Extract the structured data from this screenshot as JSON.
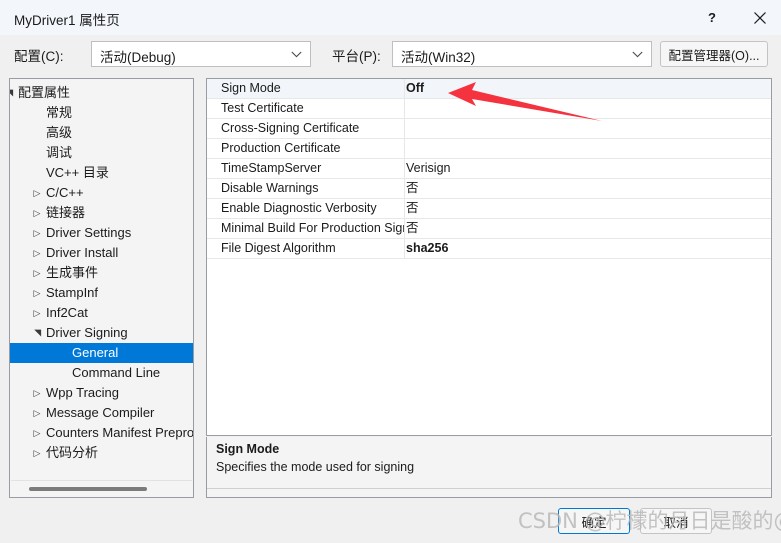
{
  "window": {
    "title": "MyDriver1 属性页",
    "help_glyph": "?",
    "close_glyph": "✕"
  },
  "config_bar": {
    "config_label": "配置(C):",
    "config_value": "活动(Debug)",
    "platform_label": "平台(P):",
    "platform_value": "活动(Win32)",
    "config_manager_button": "配置管理器(O)..."
  },
  "tree": {
    "items": [
      {
        "label": "配置属性",
        "indent": 8,
        "arrow": "▲",
        "selected": false
      },
      {
        "label": "常规",
        "indent": 36,
        "arrow": "",
        "selected": false
      },
      {
        "label": "高级",
        "indent": 36,
        "arrow": "",
        "selected": false
      },
      {
        "label": "调试",
        "indent": 36,
        "arrow": "",
        "selected": false
      },
      {
        "label": "VC++ 目录",
        "indent": 36,
        "arrow": "",
        "selected": false
      },
      {
        "label": "C/C++",
        "indent": 36,
        "arrow": "▶",
        "selected": false
      },
      {
        "label": "链接器",
        "indent": 36,
        "arrow": "▶",
        "selected": false
      },
      {
        "label": "Driver Settings",
        "indent": 36,
        "arrow": "▶",
        "selected": false
      },
      {
        "label": "Driver Install",
        "indent": 36,
        "arrow": "▶",
        "selected": false
      },
      {
        "label": "生成事件",
        "indent": 36,
        "arrow": "▶",
        "selected": false
      },
      {
        "label": "StampInf",
        "indent": 36,
        "arrow": "▶",
        "selected": false
      },
      {
        "label": "Inf2Cat",
        "indent": 36,
        "arrow": "▶",
        "selected": false
      },
      {
        "label": "Driver Signing",
        "indent": 36,
        "arrow": "▲",
        "selected": false
      },
      {
        "label": "General",
        "indent": 62,
        "arrow": "",
        "selected": true
      },
      {
        "label": "Command Line",
        "indent": 62,
        "arrow": "",
        "selected": false
      },
      {
        "label": "Wpp Tracing",
        "indent": 36,
        "arrow": "▶",
        "selected": false
      },
      {
        "label": "Message Compiler",
        "indent": 36,
        "arrow": "▶",
        "selected": false
      },
      {
        "label": "Counters Manifest Preprocessor",
        "indent": 36,
        "arrow": "▶",
        "selected": false
      },
      {
        "label": "代码分析",
        "indent": 36,
        "arrow": "▶",
        "selected": false
      }
    ]
  },
  "grid": {
    "rows": [
      {
        "name": "Sign Mode",
        "value": "Off",
        "bold": true,
        "highlight": true
      },
      {
        "name": "Test Certificate",
        "value": "",
        "bold": false,
        "highlight": false
      },
      {
        "name": "Cross-Signing Certificate",
        "value": "",
        "bold": false,
        "highlight": false
      },
      {
        "name": "Production Certificate",
        "value": "",
        "bold": false,
        "highlight": false
      },
      {
        "name": "TimeStampServer",
        "value": "Verisign",
        "bold": false,
        "highlight": false
      },
      {
        "name": "Disable Warnings",
        "value": "否",
        "bold": false,
        "highlight": false
      },
      {
        "name": "Enable Diagnostic Verbosity",
        "value": "否",
        "bold": false,
        "highlight": false
      },
      {
        "name": "Minimal Build For Production Signing",
        "value": "否",
        "bold": false,
        "highlight": false
      },
      {
        "name": "File Digest Algorithm",
        "value": "sha256",
        "bold": true,
        "highlight": false
      }
    ]
  },
  "description": {
    "title": "Sign Mode",
    "body": "Specifies the mode used for signing"
  },
  "footer": {
    "ok_label": "确定",
    "cancel_label": "取消"
  },
  "annotation": {
    "arrow_color": "#f5333f"
  },
  "watermark": {
    "text": "CSDN @柠檬的月日是酸的@"
  }
}
